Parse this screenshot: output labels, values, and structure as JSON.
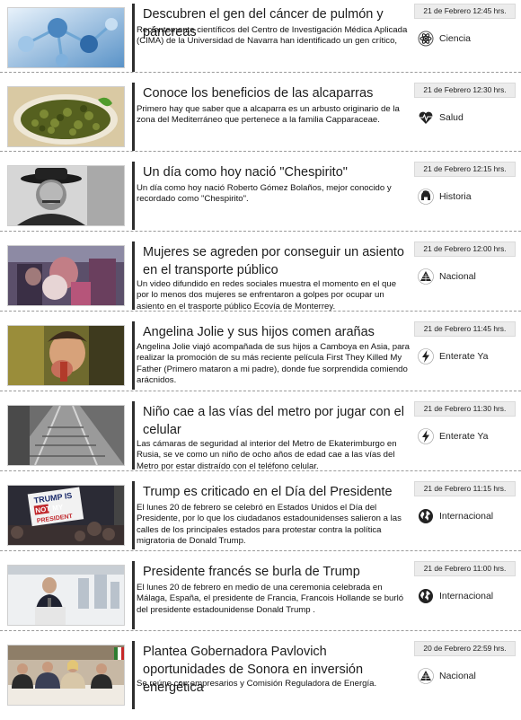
{
  "news": [
    {
      "title": "Descubren el gen del cáncer de pulmón y páncreas",
      "summary": "Recientemente científicos del Centro de Investigación Médica Aplicada (CIMA) de la Universidad de Navarra han identificado un gen crítico,",
      "date": "21 de Febrero 12:45 hrs.",
      "category": "Ciencia",
      "icon": "atom-icon",
      "thumb": "molecule"
    },
    {
      "title": "Conoce los beneficios de las alcaparras",
      "summary": "Primero hay que saber que a alcaparra es un arbusto originario de la zona del Mediterráneo que pertenece a la familia Capparaceae.",
      "date": "21 de Febrero 12:30 hrs.",
      "category": "Salud",
      "icon": "heartbeat-icon",
      "thumb": "capers"
    },
    {
      "title": "Un día como hoy nació \"Chespirito\"",
      "summary": "Un día como hoy nació Roberto Gómez Bolaños, mejor conocido y recordado como \"Chespirito\".",
      "date": "21 de Febrero 12:15 hrs.",
      "category": "Historia",
      "icon": "spartan-helmet-icon",
      "thumb": "portrait"
    },
    {
      "title": "Mujeres se agreden por conseguir un asiento en el transporte público",
      "summary": "Un video difundido en redes sociales muestra el momento en el que por lo menos dos mujeres se enfrentaron a golpes por ocupar un asiento en el trasporte público Ecovía de Monterrey.",
      "date": "21 de Febrero 12:00 hrs.",
      "category": "Nacional",
      "icon": "pyramid-icon",
      "thumb": "bus"
    },
    {
      "title": "Angelina Jolie y sus hijos comen arañas",
      "summary": "Angelina Jolie viajó acompañada de sus hijos a Camboya en Asia, para realizar la promoción de su más reciente película First They Killed My Father (Primero mataron a mi padre), donde fue sorprendida comiendo arácnidos.",
      "date": "21 de Febrero 11:45 hrs.",
      "category": "Enterate Ya",
      "icon": "lightning-icon",
      "thumb": "actress"
    },
    {
      "title": "Niño cae a las vías del metro por jugar con el celular",
      "summary": "Las cámaras de seguridad al interior del Metro de Ekaterimburgo en Rusia, se ve como un niño de ocho años de edad cae a las vías del Metro por estar distraído con el teléfono celular.",
      "date": "21 de Febrero 11:30 hrs.",
      "category": "Enterate Ya",
      "icon": "lightning-icon",
      "thumb": "metro"
    },
    {
      "title": "Trump es criticado en el Día del Presidente",
      "summary": "El lunes 20 de febrero se celebró en Estados Unidos el Día del Presidente, por lo que los ciudadanos estadounidenses salieron a las calles de los principales estados para protestar contra la política migratoria de Donald Trump.",
      "date": "21 de Febrero 11:15 hrs.",
      "category": "Internacional",
      "icon": "globe-icon",
      "thumb": "protest",
      "sign": [
        "TRUMP IS",
        "NOT MY",
        "PRESIDENT"
      ]
    },
    {
      "title": "Presidente francés se burla de Trump",
      "summary": "El lunes 20 de febrero en medio de una ceremonia celebrada en Málaga, España, el presidente de Francia, Francois Hollande se burló del presidente estadounidense Donald Trump .",
      "date": "21 de Febrero 11:00 hrs.",
      "category": "Internacional",
      "icon": "globe-icon",
      "thumb": "podium"
    },
    {
      "title": "Plantea Gobernadora Pavlovich oportunidades de Sonora en inversión energética",
      "summary": "Se reúne con empresarios y Comisión Reguladora de Energía.",
      "date": "20 de Febrero 22:59 hrs.",
      "category": "Nacional",
      "icon": "pyramid-icon",
      "thumb": "panel"
    }
  ]
}
